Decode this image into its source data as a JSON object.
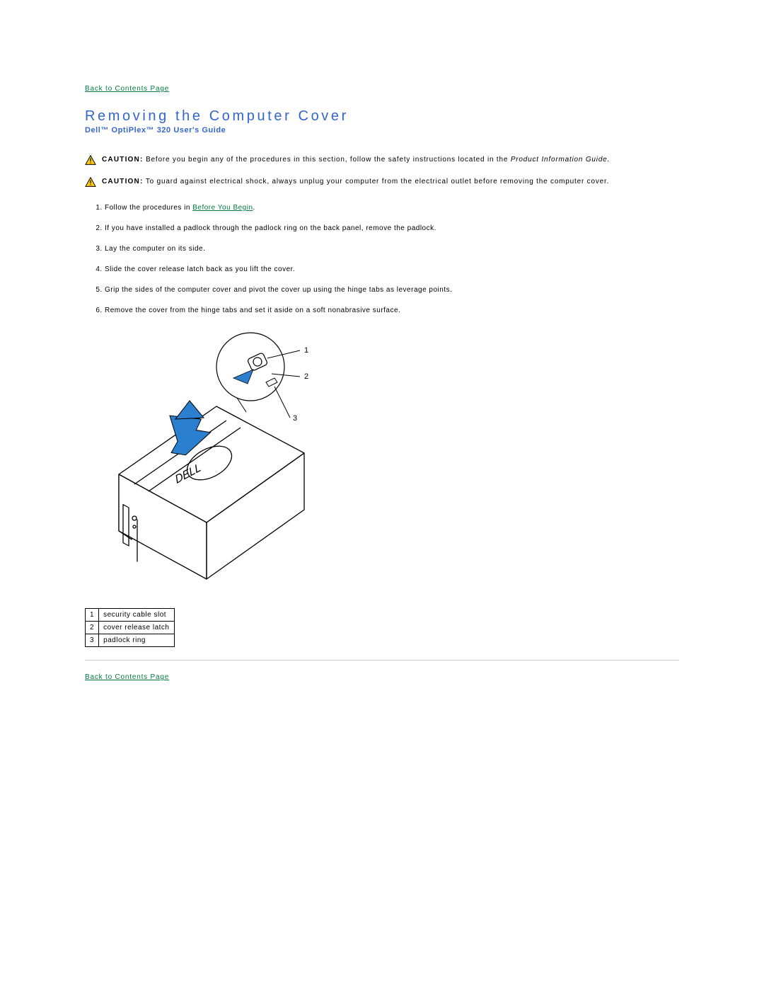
{
  "nav": {
    "back_top": "Back to Contents Page",
    "back_bottom": "Back to Contents Page"
  },
  "header": {
    "title": "Removing the Computer Cover",
    "subtitle": "Dell™ OptiPlex™ 320 User's Guide"
  },
  "caution1": {
    "label": "CAUTION:",
    "text": " Before you begin any of the procedures in this section, follow the safety instructions located in the ",
    "italic": "Product Information Guide.",
    "after": ""
  },
  "caution2": {
    "label": "CAUTION:",
    "text": " To guard against electrical shock, always unplug your computer from the electrical outlet before removing the computer cover."
  },
  "steps": {
    "s1a": "Follow the procedures in ",
    "s1link": "Before You Begin",
    "s1b": ".",
    "s2": "If you have installed a padlock through the padlock ring on the back panel, remove the padlock.",
    "s3": "Lay the computer on its side.",
    "s4": "Slide the cover release latch back as you lift the cover.",
    "s5": "Grip the sides of the computer cover and pivot the cover up using the hinge tabs as leverage points.",
    "s6": "Remove the cover from the hinge tabs and set it aside on a soft nonabrasive surface."
  },
  "figure": {
    "callout1": "1",
    "callout2": "2",
    "callout3": "3"
  },
  "table": {
    "r1n": "1",
    "r1t": "security cable slot",
    "r2n": "2",
    "r2t": "cover release latch",
    "r3n": "3",
    "r3t": "padlock ring"
  }
}
